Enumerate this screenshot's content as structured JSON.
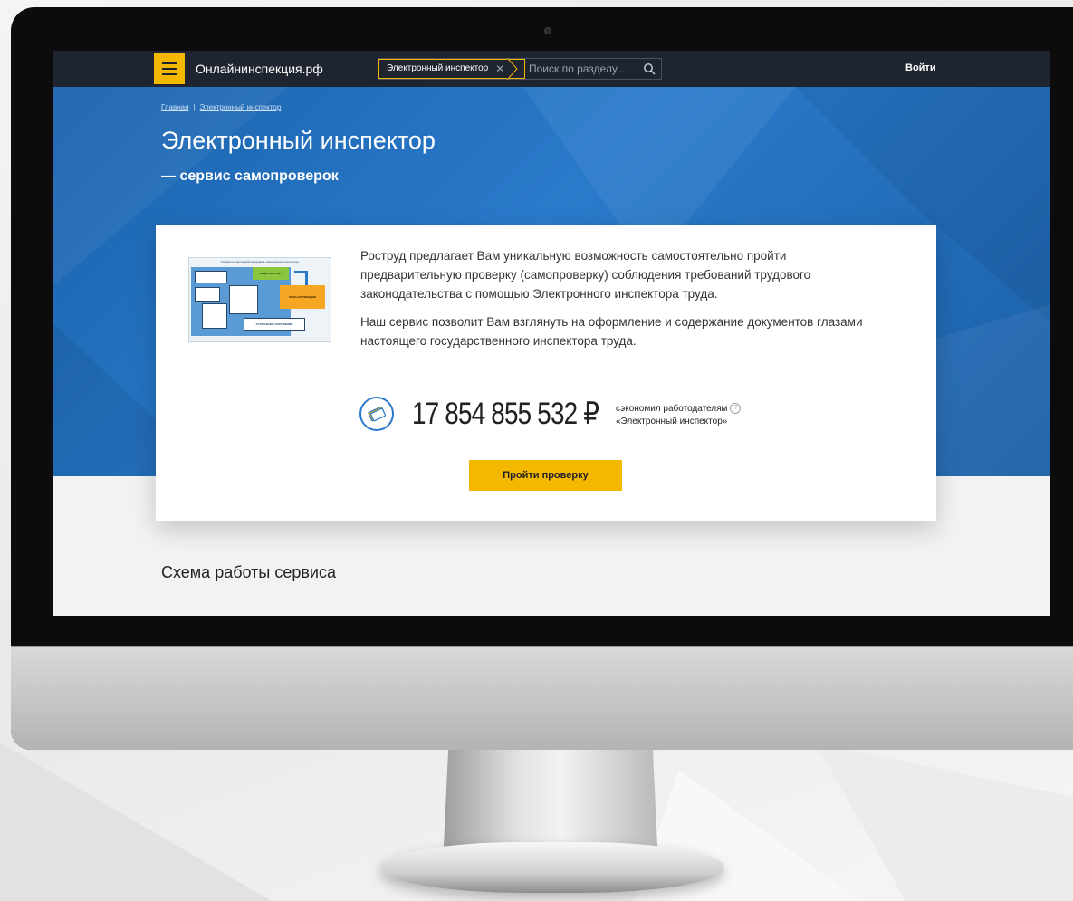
{
  "colors": {
    "brand_yellow": "#f5b800",
    "nav_dark": "#1f2530",
    "hero_blue": "#2a7acb",
    "text_dark": "#222222"
  },
  "topbar": {
    "menu_icon": "hamburger-icon",
    "site_name": "Онлайнинспекция.рф",
    "search_tag": "Электронный инспектор",
    "search_tag_close": "✕",
    "search_placeholder": "Поиск по разделу...",
    "search_icon": "search-icon",
    "login_label": "Войти"
  },
  "breadcrumb": {
    "items": [
      "Главная",
      "Электронный инспектор"
    ],
    "separator": "|"
  },
  "hero": {
    "title": "Электронный инспектор",
    "subtitle": "— сервис самопроверок"
  },
  "card": {
    "thumbnail": {
      "heading": "Типовая алгоритм работы сервиса «Электронный инспектор»",
      "block_1": "АУДИТОРЫ ОБТ",
      "block_2": "МЕРЫ МОТИВАЦИИ",
      "block_3": "УСТРАНЕНИЕ НАРУШЕНИЙ"
    },
    "paragraph_1": "Роструд предлагает Вам уникальную возможность самостоятельно пройти предварительную проверку (самопроверку) соблюдения требований трудового законодательства с помощью Электронного инспектора труда.",
    "paragraph_2": "Наш сервис позволит Вам взглянуть на оформление и содержание документов глазами настоящего государственного инспектора труда.",
    "counter_icon": "money-coin-icon",
    "counter_value": "17 854 855 532 ₽",
    "counter_caption_line1": "сэкономил работодателям",
    "counter_caption_line2": "«Электронный инспектор»",
    "help_icon": "?",
    "cta_label": "Пройти проверку"
  },
  "section": {
    "title": "Схема работы сервиса"
  }
}
